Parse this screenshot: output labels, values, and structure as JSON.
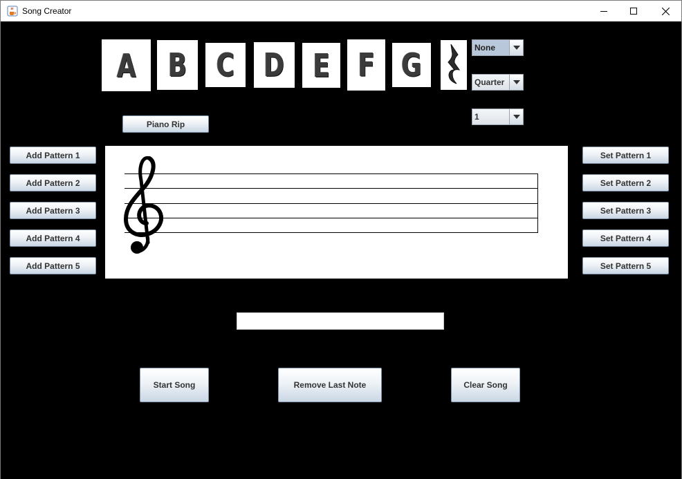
{
  "window": {
    "title": "Song Creator",
    "app_icon": "java-coffee-icon",
    "controls": [
      "minimize-icon",
      "maximize-icon",
      "close-icon"
    ]
  },
  "notes": [
    "A",
    "B",
    "C",
    "D",
    "E",
    "F",
    "G"
  ],
  "rest_icon": "quarter-rest-icon",
  "dropdowns": {
    "accidental": "None",
    "duration": "Quarter",
    "octave": "1"
  },
  "piano_rip_label": "Piano Rip",
  "add_patterns": [
    "Add Pattern 1",
    "Add Pattern 2",
    "Add Pattern 3",
    "Add Pattern 4",
    "Add Pattern 5"
  ],
  "set_patterns": [
    "Set Pattern 1",
    "Set Pattern 2",
    "Set Pattern 3",
    "Set Pattern 4",
    "Set Pattern 5"
  ],
  "staff": {
    "clef_icon": "treble-clef-icon",
    "line_count": 5
  },
  "song_text_value": "",
  "actions": {
    "start": "Start Song",
    "remove": "Remove Last Note",
    "clear": "Clear Song"
  },
  "colors": {
    "background": "#000000",
    "button_gradient_bottom": "#c9d6e4",
    "panel": "#ffffff"
  }
}
